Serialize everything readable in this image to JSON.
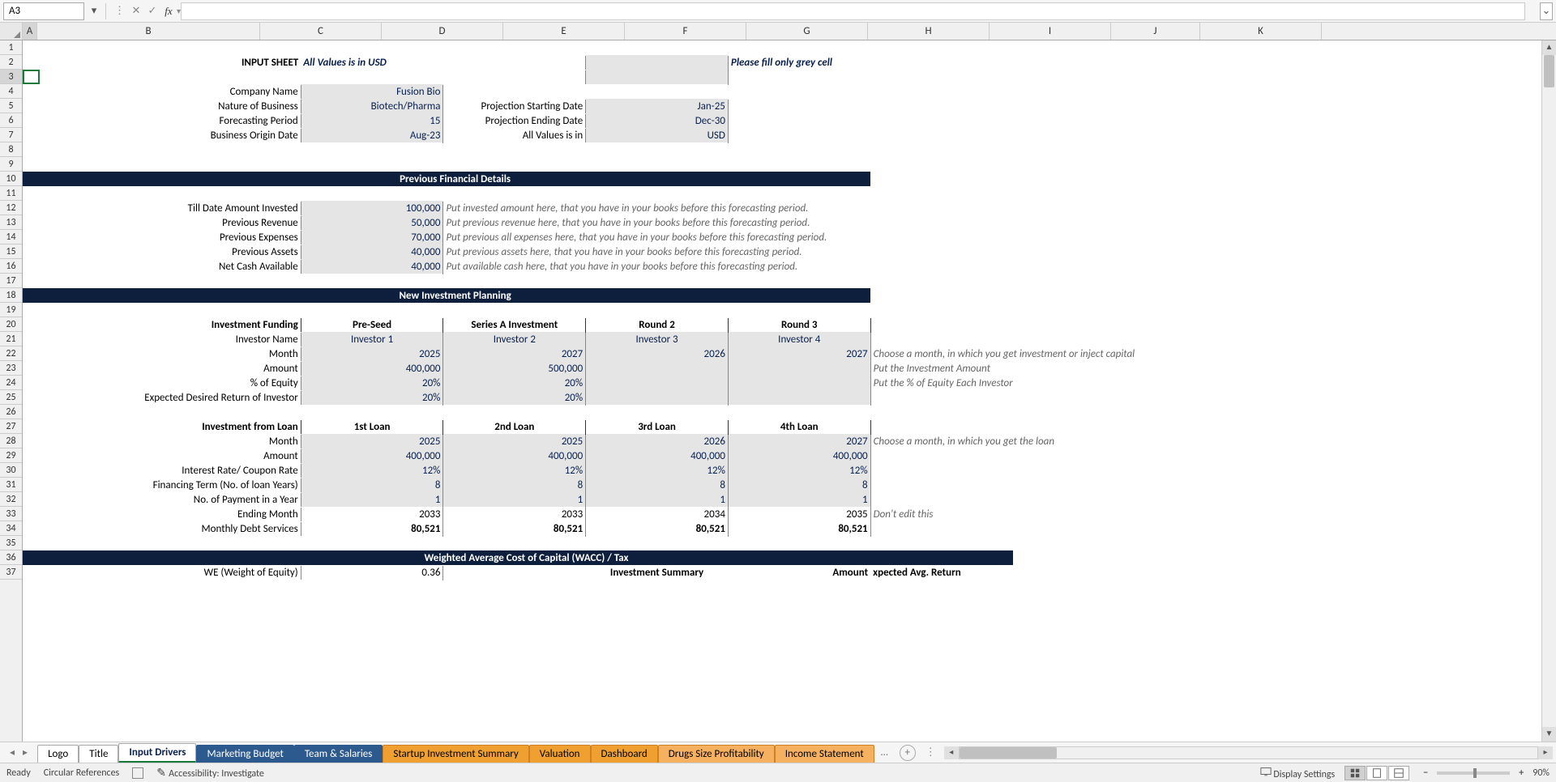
{
  "nameBox": "A3",
  "formulaValue": "",
  "columns": [
    "A",
    "B",
    "C",
    "D",
    "E",
    "F",
    "G",
    "H",
    "I",
    "J",
    "K"
  ],
  "rows": 37,
  "selectedRow": 3,
  "selectedCol": "A",
  "r2": {
    "b": "INPUT SHEET",
    "c": "All Values is in USD",
    "f": "Please fill only grey cell"
  },
  "r4": {
    "b": "Company Name",
    "c": "Fusion Bio"
  },
  "r5": {
    "b": "Nature of Business",
    "c": "Biotech/Pharma",
    "d": "Projection Starting Date",
    "e": "Jan-25"
  },
  "r6": {
    "b": "Forecasting Period",
    "c": "15",
    "d": "Projection Ending Date",
    "e": "Dec-30"
  },
  "r7": {
    "b": "Business Origin Date",
    "c": "Aug-23",
    "d": "All Values is in",
    "e": "USD"
  },
  "r10": {
    "title": "Previous Financial Details"
  },
  "r12": {
    "b": "Till Date Amount Invested",
    "c": "100,000",
    "d": "Put invested amount here, that you have in your books before this forecasting period."
  },
  "r13": {
    "b": "Previous Revenue",
    "c": "50,000",
    "d": "Put previous revenue here, that you have in your books before this forecasting period."
  },
  "r14": {
    "b": "Previous Expenses",
    "c": "70,000",
    "d": "Put previous all expenses here, that you have in your books before this forecasting period."
  },
  "r15": {
    "b": "Previous Assets",
    "c": "40,000",
    "d": "Put previous assets here, that you have in your books before this forecasting period."
  },
  "r16": {
    "b": "Net Cash Available",
    "c": "40,000",
    "d": "Put available cash here, that you have in your books before this forecasting period."
  },
  "r18": {
    "title": "New Investment Planning"
  },
  "r20": {
    "b": "Investment Funding",
    "c": "Pre-Seed",
    "d": "Series A Investment",
    "e": "Round 2",
    "f": "Round 3"
  },
  "r21": {
    "b": "Investor Name",
    "c": "Investor 1",
    "d": "Investor 2",
    "e": "Investor 3",
    "f": "Investor 4"
  },
  "r22": {
    "b": "Month",
    "c": "2025",
    "d": "2027",
    "e": "2026",
    "f": "2027",
    "g": "Choose a month, in which you get investment or inject capital"
  },
  "r23": {
    "b": "Amount",
    "c": "400,000",
    "d": "500,000",
    "e": "",
    "f": "",
    "g": "Put the Investment Amount"
  },
  "r24": {
    "b": "% of Equity",
    "c": "20%",
    "d": "20%",
    "e": "",
    "f": "",
    "g": "Put the % of Equity Each Investor"
  },
  "r25": {
    "b": "Expected Desired Return of Investor",
    "c": "20%",
    "d": "20%",
    "e": "",
    "f": ""
  },
  "r27": {
    "b": "Investment from Loan",
    "c": "1st Loan",
    "d": "2nd Loan",
    "e": "3rd Loan",
    "f": "4th Loan"
  },
  "r28": {
    "b": "Month",
    "c": "2025",
    "d": "2025",
    "e": "2026",
    "f": "2027",
    "g": "Choose a month, in which you get the loan"
  },
  "r29": {
    "b": "Amount",
    "c": "400,000",
    "d": "400,000",
    "e": "400,000",
    "f": "400,000"
  },
  "r30": {
    "b": "Interest Rate/ Coupon Rate",
    "c": "12%",
    "d": "12%",
    "e": "12%",
    "f": "12%"
  },
  "r31": {
    "b": "Financing Term (No. of loan Years)",
    "c": "8",
    "d": "8",
    "e": "8",
    "f": "8"
  },
  "r32": {
    "b": "No. of Payment in a Year",
    "c": "1",
    "d": "1",
    "e": "1",
    "f": "1"
  },
  "r33": {
    "b": "Ending Month",
    "c": "2033",
    "d": "2033",
    "e": "2034",
    "f": "2035",
    "g": "Don't edit this"
  },
  "r34": {
    "b": "Monthly Debt Services",
    "c": "80,521",
    "d": "80,521",
    "e": "80,521",
    "f": "80,521"
  },
  "r36": {
    "title": "Weighted Average Cost of Capital (WACC) / Tax"
  },
  "r37": {
    "b": "WE (Weight of Equity)",
    "c": "0.36",
    "e": "Investment Summary",
    "f": "Amount",
    "g": "xpected Avg. Return"
  },
  "tabs": [
    {
      "label": "Logo",
      "cls": ""
    },
    {
      "label": "Title",
      "cls": ""
    },
    {
      "label": "Input Drivers",
      "cls": "active"
    },
    {
      "label": "Marketing Budget",
      "cls": "blue"
    },
    {
      "label": "Team & Salaries",
      "cls": "blue"
    },
    {
      "label": "Startup Investment Summary",
      "cls": "orange"
    },
    {
      "label": "Valuation",
      "cls": "orange"
    },
    {
      "label": "Dashboard",
      "cls": "orange"
    },
    {
      "label": "Drugs Size Profitability",
      "cls": "orange2"
    },
    {
      "label": "Income Statement",
      "cls": "orange2"
    }
  ],
  "status": {
    "ready": "Ready",
    "circ": "Circular References",
    "acc": "Accessibility: Investigate",
    "disp": "Display Settings",
    "zoom": "90%"
  }
}
